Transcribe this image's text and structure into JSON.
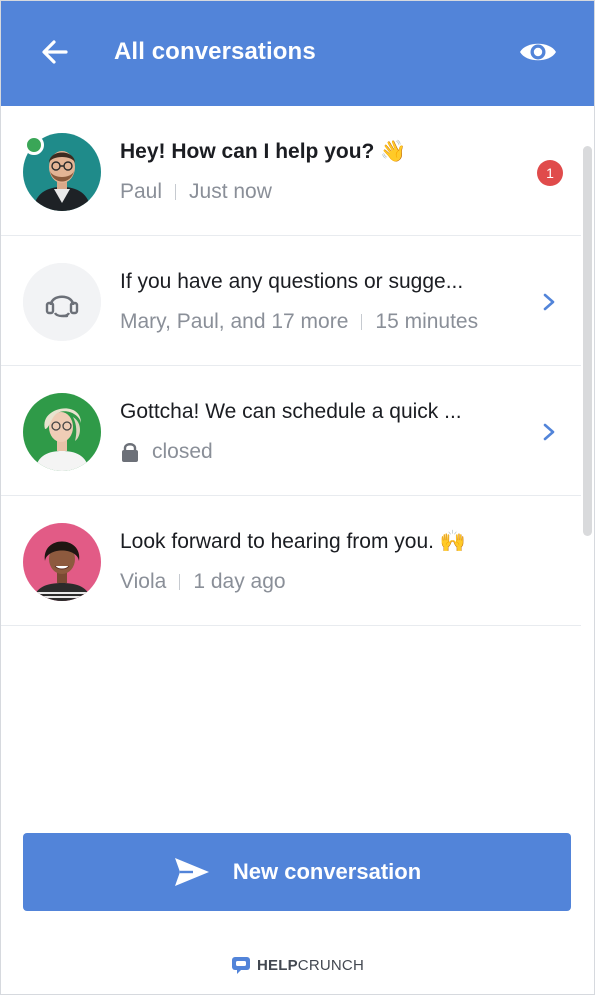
{
  "header": {
    "title": "All conversations",
    "back_icon": "arrow-left-icon",
    "view_icon": "eye-icon",
    "background": "#5284d9"
  },
  "conversations": [
    {
      "title": "Hey! How can I help you? 👋",
      "sender": "Paul",
      "time": "Just now",
      "unread_count": "1",
      "online": true,
      "avatar": "paul-avatar"
    },
    {
      "title": "If you have any questions or sugge...",
      "sender": "Mary, Paul, and 17 more",
      "time": "15 minutes",
      "avatar": "support-agent-icon"
    },
    {
      "title": "Gottcha! We can schedule a quick ...",
      "status": "closed",
      "status_icon": "lock-icon",
      "avatar": "woman-avatar"
    },
    {
      "title": "Look forward to hearing from you. 🙌",
      "sender": "Viola",
      "time": "1 day ago",
      "avatar": "viola-avatar"
    }
  ],
  "new_conversation": {
    "label": "New conversation",
    "icon": "send-icon"
  },
  "brand": {
    "part1": "HELP",
    "part2": "CRUNCH"
  },
  "colors": {
    "accent": "#5284d9",
    "badge": "#e04b4b",
    "online": "#3aa657"
  }
}
